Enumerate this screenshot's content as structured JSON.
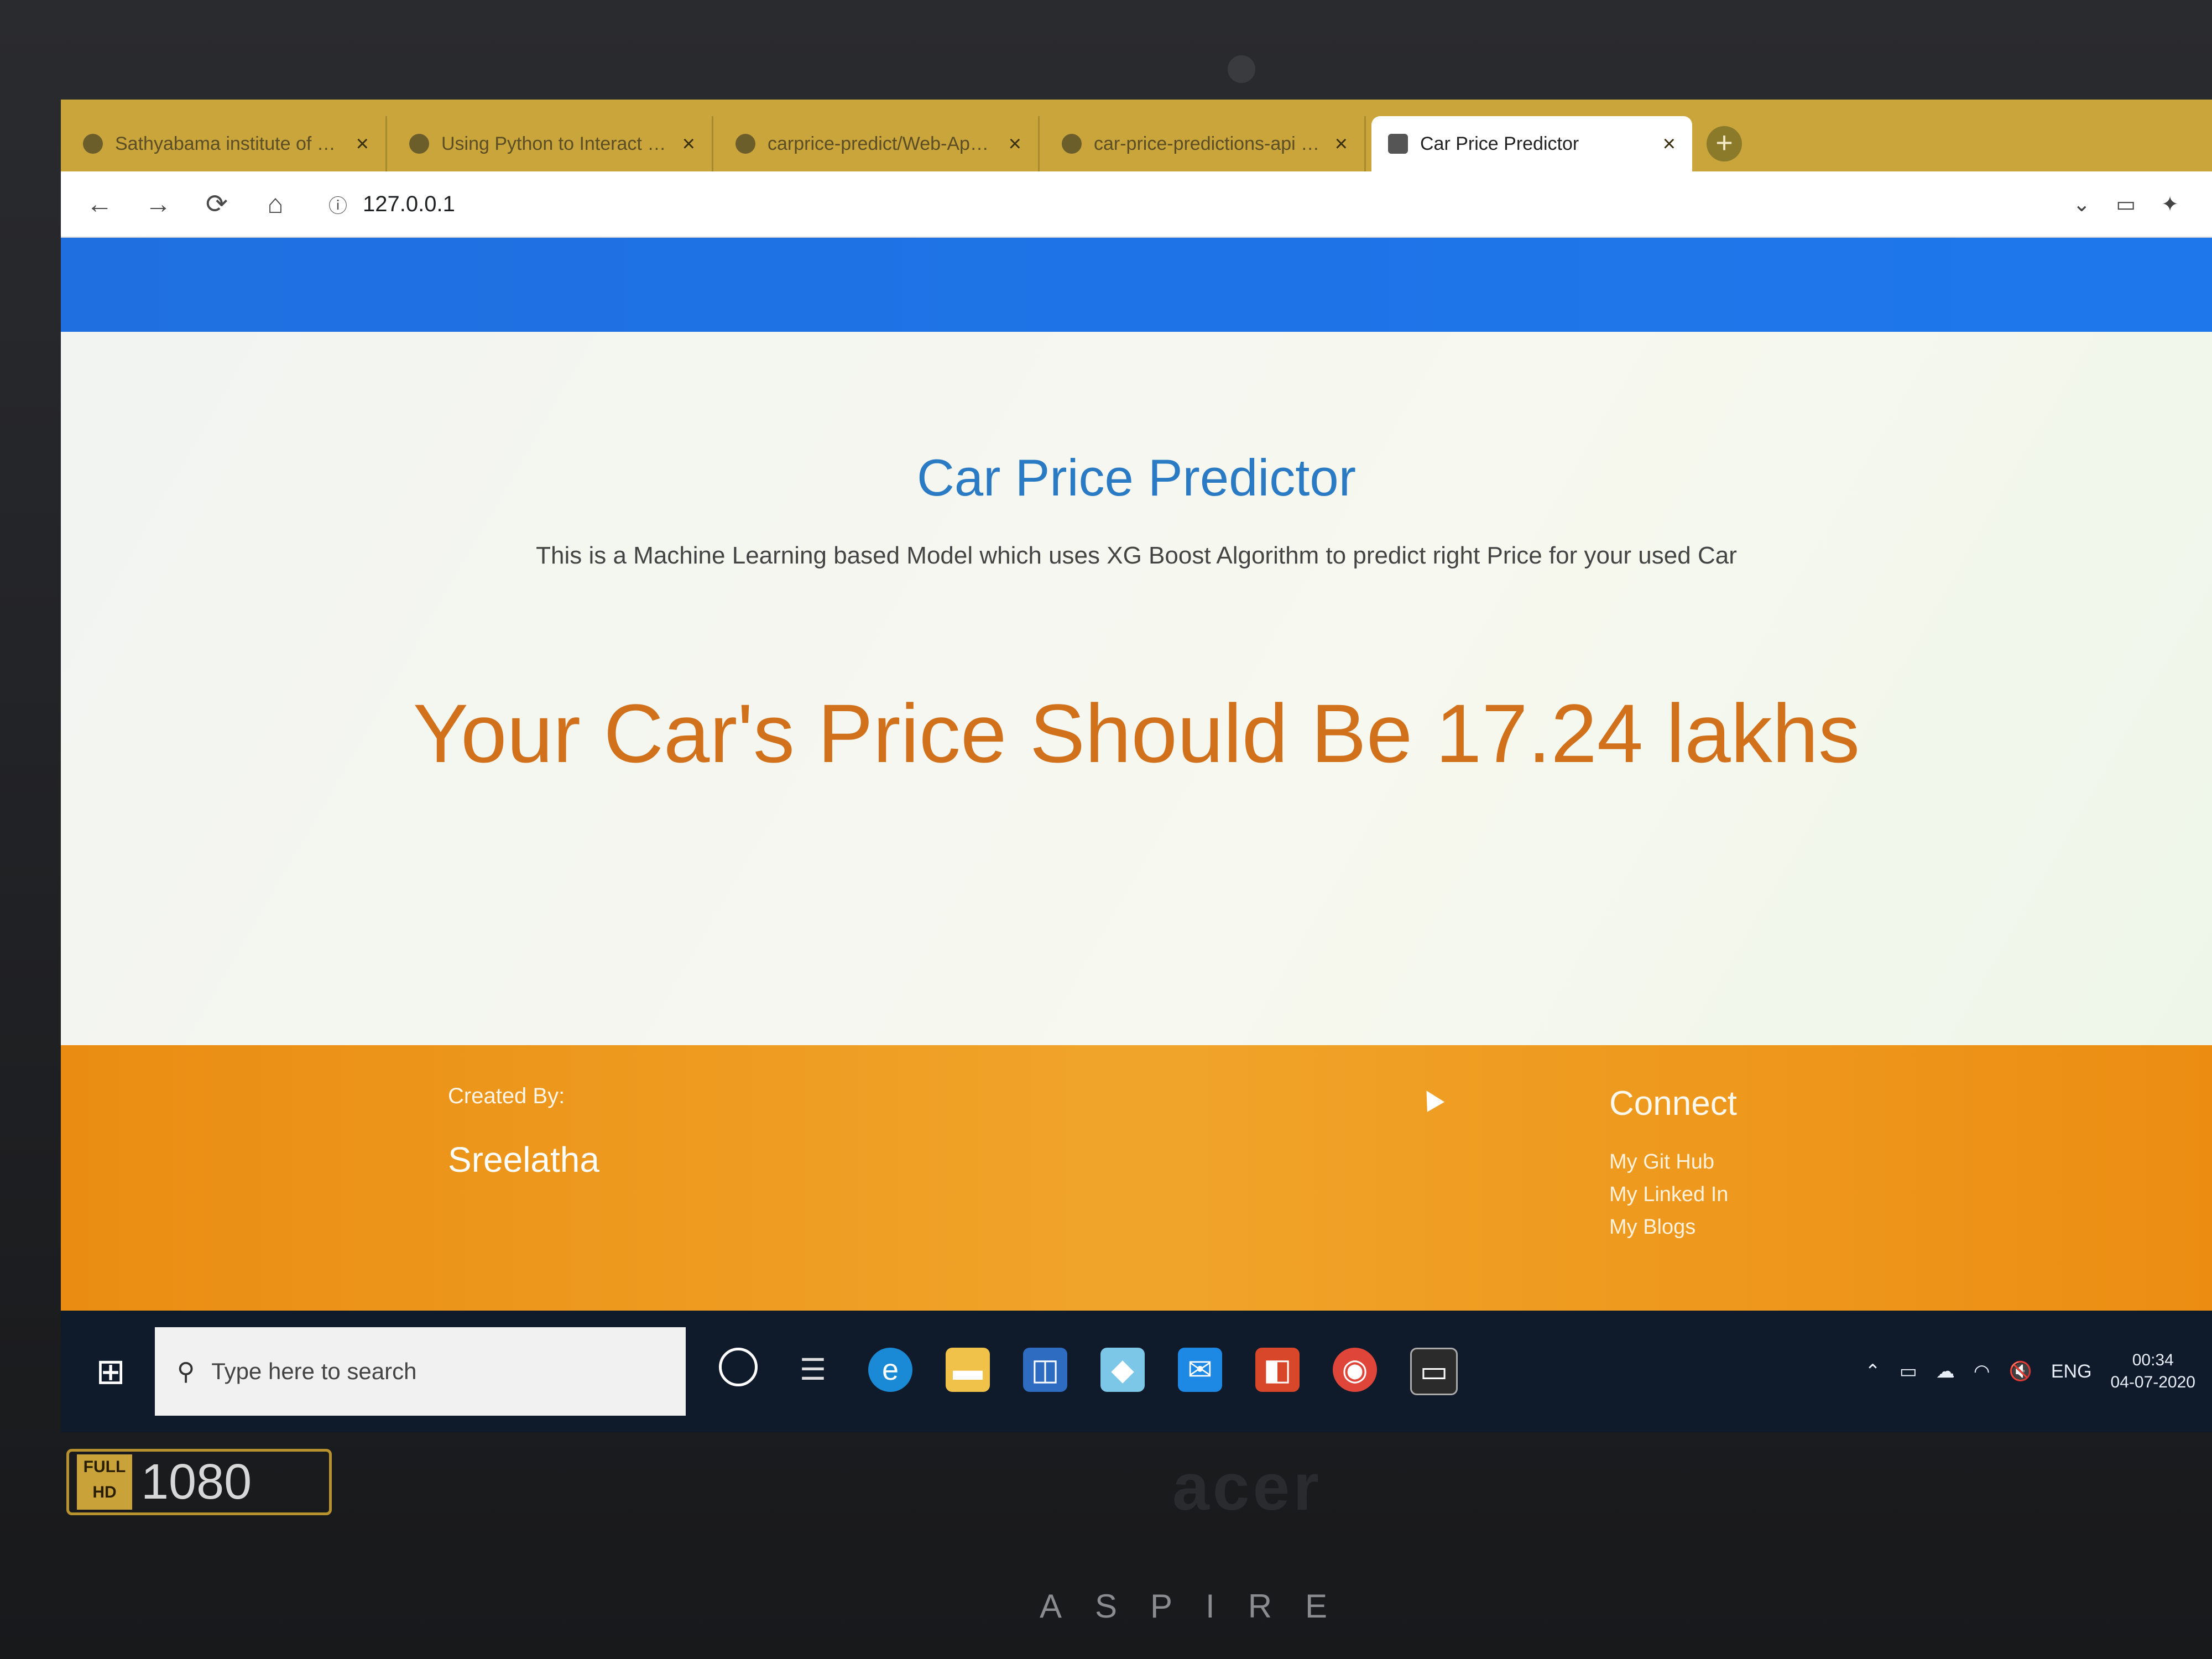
{
  "browser": {
    "tabs": [
      {
        "title": "Sathyabama institute of Science",
        "active": false
      },
      {
        "title": "Using Python to Interact with the",
        "active": false
      },
      {
        "title": "carprice-predict/Web-App-Car-P",
        "active": false
      },
      {
        "title": "car-price-predictions-api · GitHub",
        "active": false
      },
      {
        "title": "Car Price Predictor",
        "active": true
      }
    ],
    "new_tab_label": "+",
    "url": "127.0.0.1",
    "close_glyph": "×"
  },
  "page": {
    "title": "Car Price Predictor",
    "subtitle": "This is a Machine Learning based Model which uses XG Boost Algorithm to predict right Price for your used Car",
    "result": "Your Car's Price Should Be 17.24 lakhs"
  },
  "footer": {
    "created_label": "Created By:",
    "created_name": "Sreelatha",
    "connect_title": "Connect",
    "links": [
      "My Git Hub",
      "My Linked In",
      "My Blogs"
    ]
  },
  "taskbar": {
    "search_placeholder": "Type here to search",
    "language": "ENG",
    "time": "00:34",
    "date": "04-07-2020"
  },
  "bezel": {
    "hd_label": "FULL HD",
    "resolution": "1080",
    "brand": "acer",
    "model": "ASPIRE"
  },
  "colors": {
    "navbar": "#1e78ec",
    "title": "#2a7bc4",
    "result": "#d2711c",
    "footer": "#f0a52a"
  }
}
